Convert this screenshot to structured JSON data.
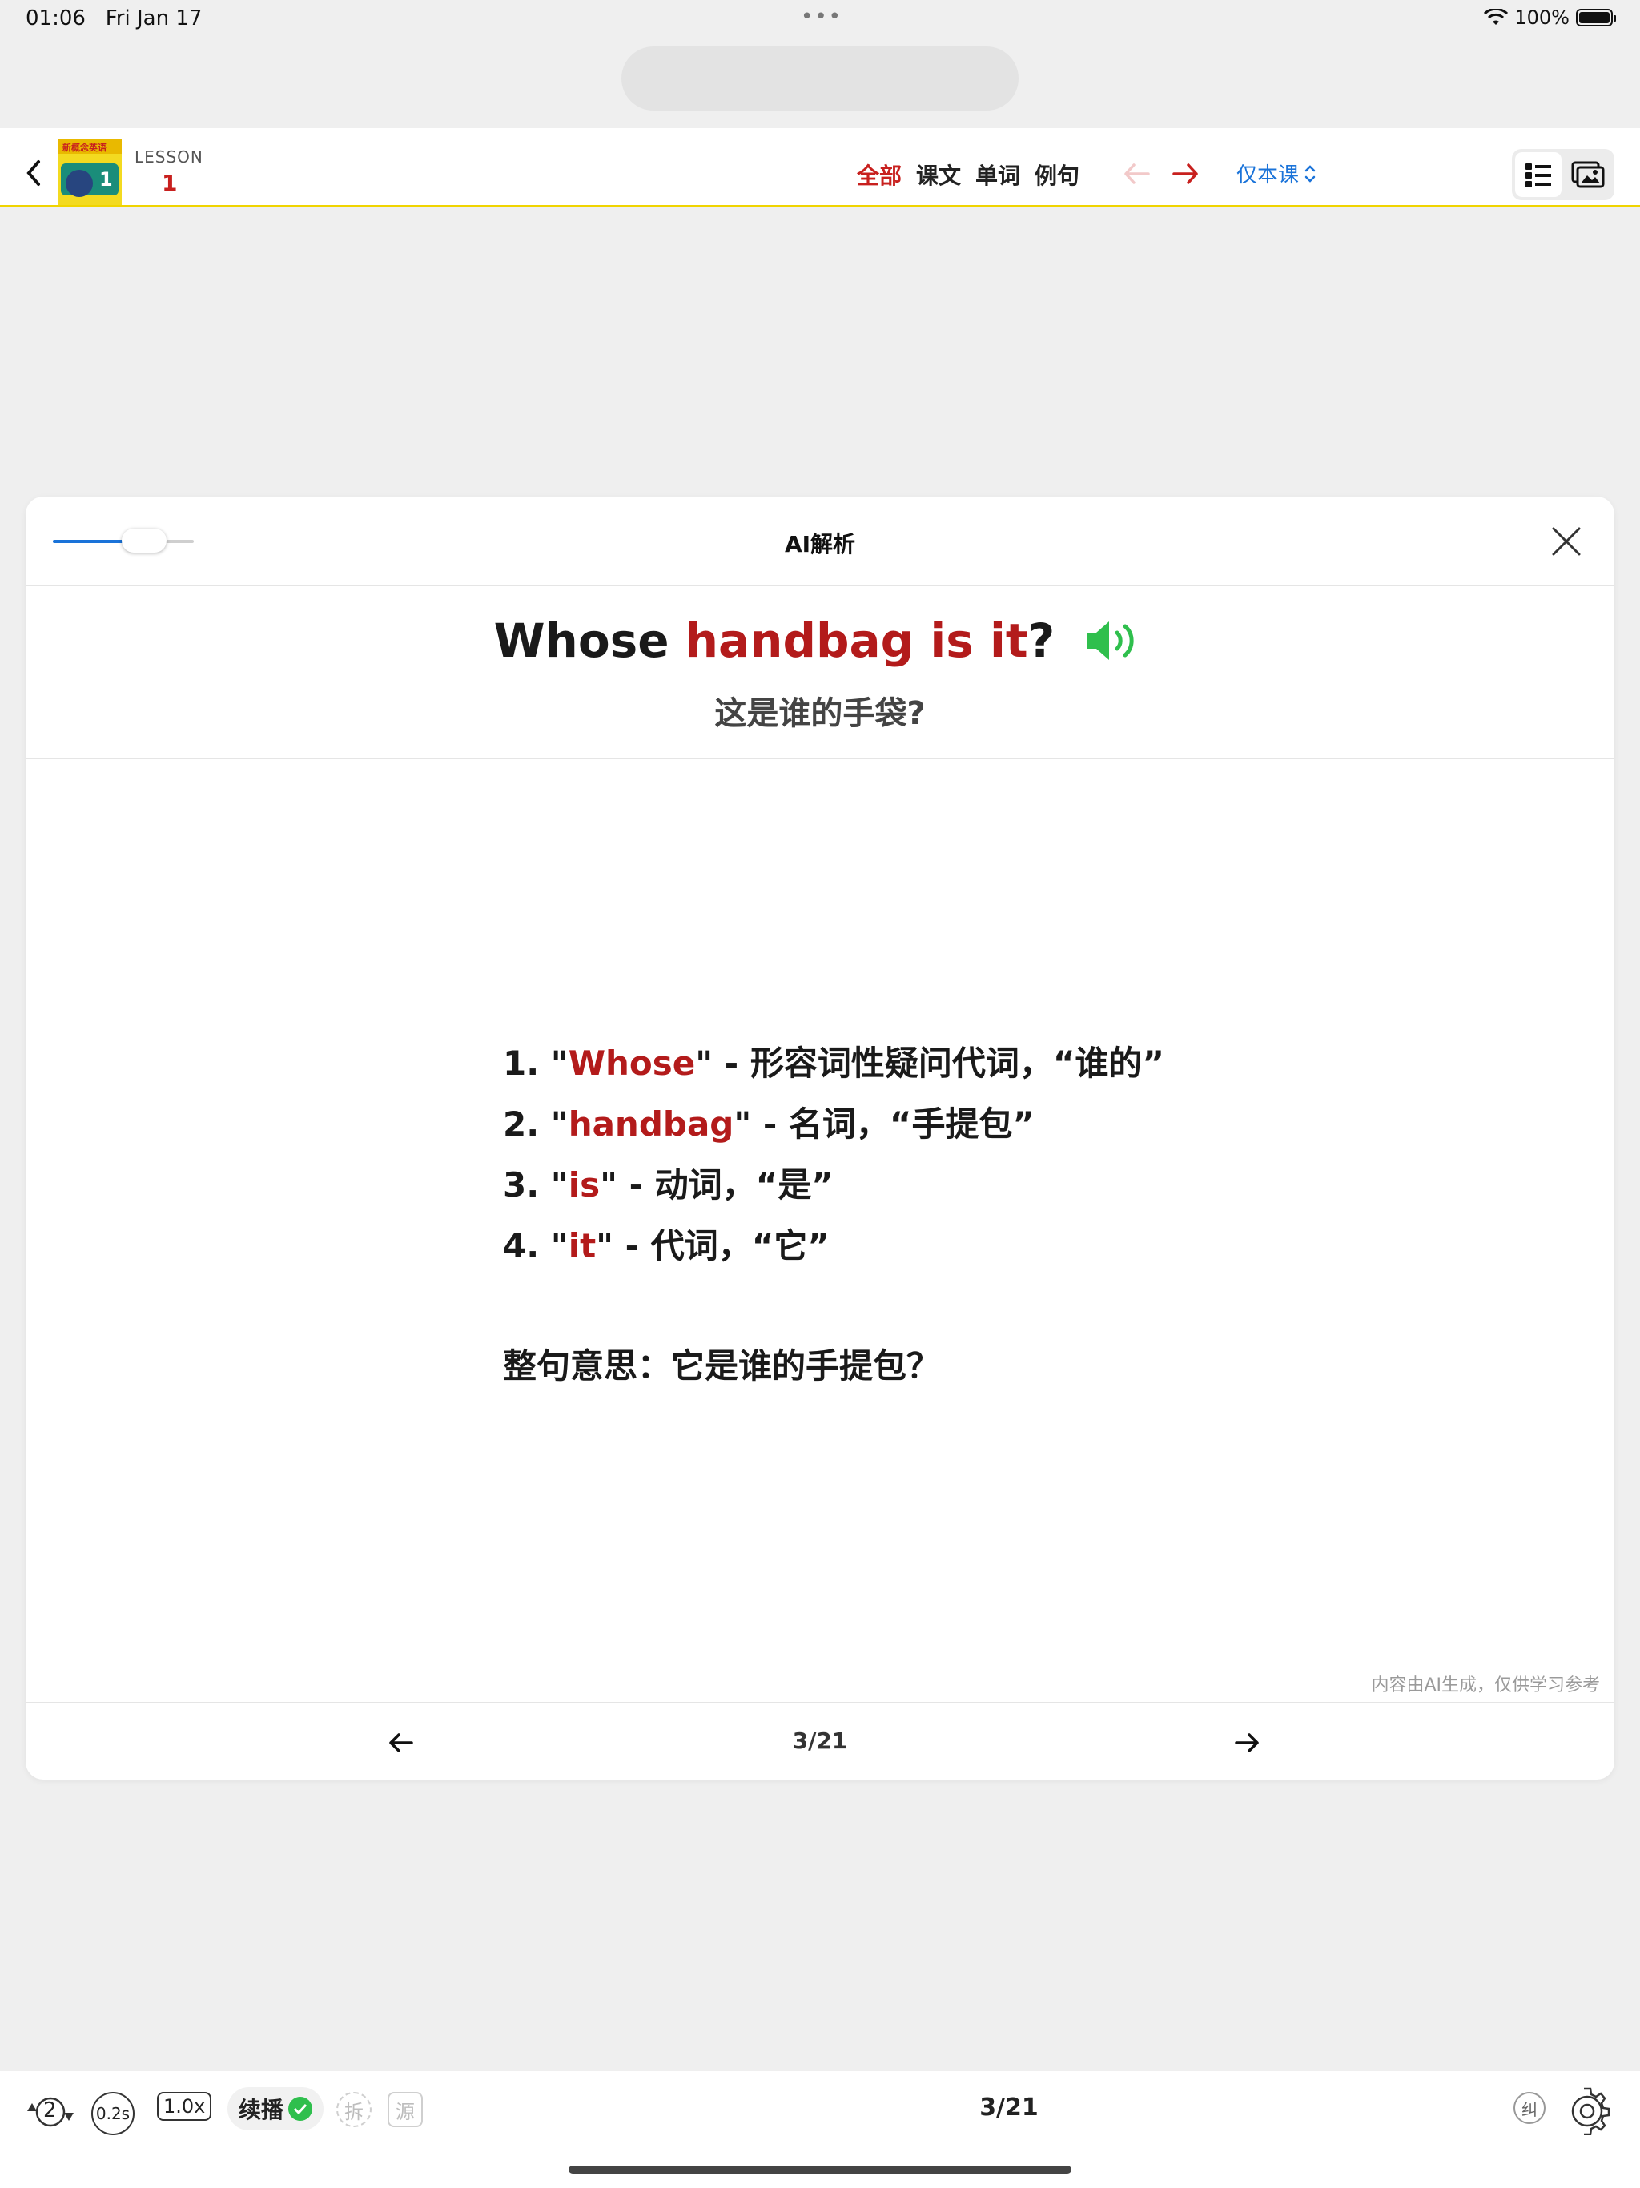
{
  "status": {
    "time": "01:06",
    "date": "Fri Jan 17",
    "dots": "•••",
    "battery": "100%"
  },
  "header": {
    "lesson_label": "LESSON",
    "lesson_number": "1",
    "book_cover_title": "新概念英语",
    "book_cover_number": "1",
    "tabs": [
      {
        "label": "全部",
        "active": true
      },
      {
        "label": "课文"
      },
      {
        "label": "单词"
      },
      {
        "label": "例句"
      }
    ],
    "scope": "仅本课"
  },
  "card": {
    "title": "AI解析",
    "sentence_en": {
      "part1": "Whose ",
      "part2": "handbag is it",
      "part3": "?"
    },
    "sentence_cn": "这是谁的手袋?",
    "analysis": [
      {
        "prefix": "1. \"",
        "word": "Whose",
        "rest": "\" - 形容词性疑问代词，“谁的”"
      },
      {
        "prefix": "2. \"",
        "word": "handbag",
        "rest": "\" - 名词，“手提包”"
      },
      {
        "prefix": "3. \"",
        "word": "is",
        "rest": "\" - 动词，“是”"
      },
      {
        "prefix": "4. \"",
        "word": "it",
        "rest": "\" - 代词，“它”"
      }
    ],
    "summary": "整句意思：它是谁的手提包？",
    "disclaimer": "内容由AI生成，仅供学习参考",
    "page": "3/21"
  },
  "bottom_bar": {
    "repeat_count": "2",
    "delay": "0.2s",
    "speed": "1.0x",
    "autoplay_label": "续播",
    "split_label": "拆",
    "source_label": "源",
    "page": "3/21",
    "correct_label": "纠"
  },
  "colors": {
    "accent_red": "#c8201e",
    "link_blue": "#1a73d9",
    "speaker_green": "#2fbf4d"
  }
}
